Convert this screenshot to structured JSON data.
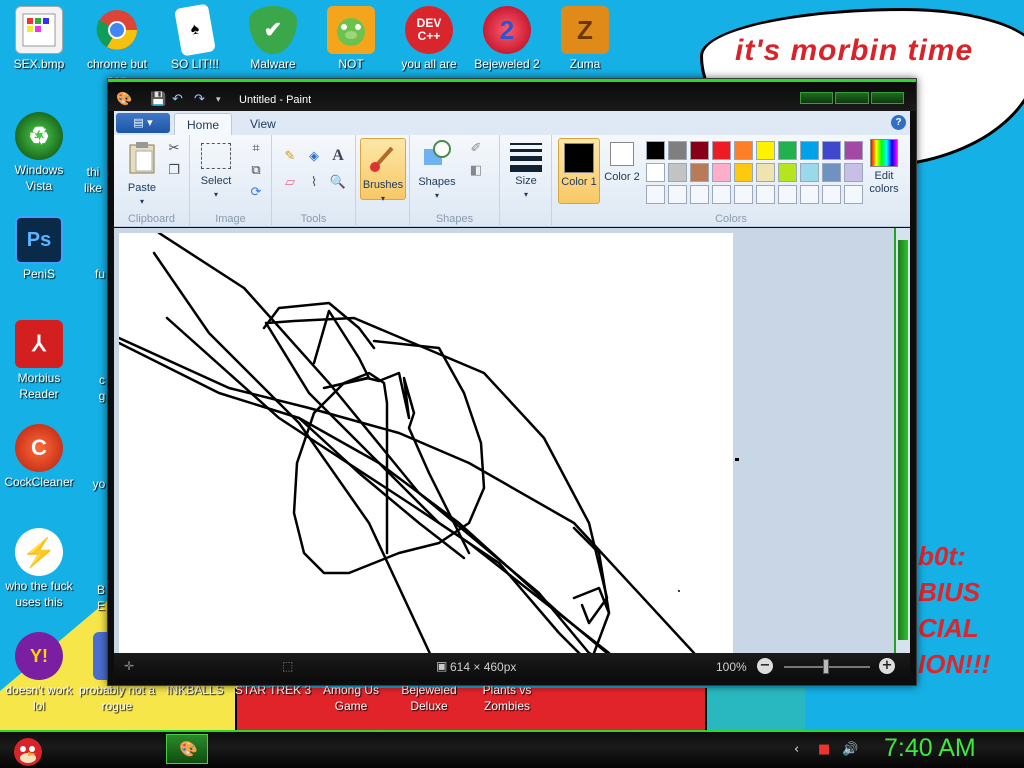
{
  "wallpaper": {
    "cloud_text": "it's morbin time",
    "side_text_lines": [
      "b0t:",
      "BIUS",
      "CIAL",
      "ION!!!"
    ]
  },
  "desktop_icons": [
    {
      "label": "SEX.bmp",
      "icon": "paint-file-icon"
    },
    {
      "label": "chrome but non",
      "icon": "chrome-icon"
    },
    {
      "label": "SO LIT!!!",
      "icon": "solitaire-icon"
    },
    {
      "label": "Malware",
      "icon": "shield-icon"
    },
    {
      "label": "NOT",
      "icon": "angry-birds-pig-icon"
    },
    {
      "label": "you all are",
      "icon": "dev-cpp-icon"
    },
    {
      "label": "Bejeweled 2",
      "icon": "bejeweled-icon"
    },
    {
      "label": "Zuma",
      "icon": "zuma-icon"
    },
    {
      "label": "Windows Vista",
      "icon": "recycle-icon"
    },
    {
      "label": "PeniS",
      "icon": "photoshop-icon"
    },
    {
      "label": "Morbius Reader",
      "icon": "pdf-reader-icon"
    },
    {
      "label": "CockCleaner",
      "icon": "ccleaner-icon"
    },
    {
      "label": "who the fuck uses this",
      "icon": "flash-icon"
    },
    {
      "label": "doesn't work lol",
      "icon": "yahoo-messenger-icon"
    },
    {
      "label": "probably not a rogue",
      "icon": "shield-blue-icon"
    },
    {
      "label": "INKBALLS",
      "icon": "inkball-icon"
    },
    {
      "label": "STAR TREK 3",
      "icon": "star-trek-icon"
    },
    {
      "label": "Among Us Game",
      "icon": "among-us-icon"
    },
    {
      "label": "Bejeweled Deluxe",
      "icon": "bejeweled-deluxe-icon"
    },
    {
      "label": "Plants vs Zombies",
      "icon": "pvz-icon"
    }
  ],
  "partial_icons": [
    "thi like",
    "fu",
    "c g",
    "yo",
    "B E"
  ],
  "window": {
    "title": "Untitled - Paint",
    "file_menu_glyph": "▤ ▾",
    "tabs": [
      "Home",
      "View"
    ],
    "groups": {
      "clipboard": {
        "label": "Clipboard",
        "paste": "Paste"
      },
      "image": {
        "label": "Image",
        "select": "Select"
      },
      "tools": {
        "label": "Tools"
      },
      "brushes": {
        "label": "Brushes"
      },
      "shapes": {
        "label": "Shapes",
        "shapes_btn": "Shapes"
      },
      "size": {
        "label": "Size"
      },
      "colors": {
        "label": "Colors",
        "color1": "Color 1",
        "color2": "Color 2",
        "edit": "Edit colors",
        "row1": [
          "#000000",
          "#7f7f7f",
          "#880015",
          "#ed1c24",
          "#ff7f27",
          "#fff200",
          "#22b14c",
          "#00a2e8",
          "#3f48cc",
          "#a349a4"
        ],
        "row2": [
          "#ffffff",
          "#c3c3c3",
          "#b97a57",
          "#ffaec9",
          "#ffc90e",
          "#efe4b0",
          "#b5e61d",
          "#99d9ea",
          "#7092be",
          "#c8bfe7"
        ]
      }
    },
    "status": {
      "size": "614 × 460px",
      "zoom": "100%"
    }
  },
  "taskbar": {
    "clock": "7:40 AM"
  }
}
